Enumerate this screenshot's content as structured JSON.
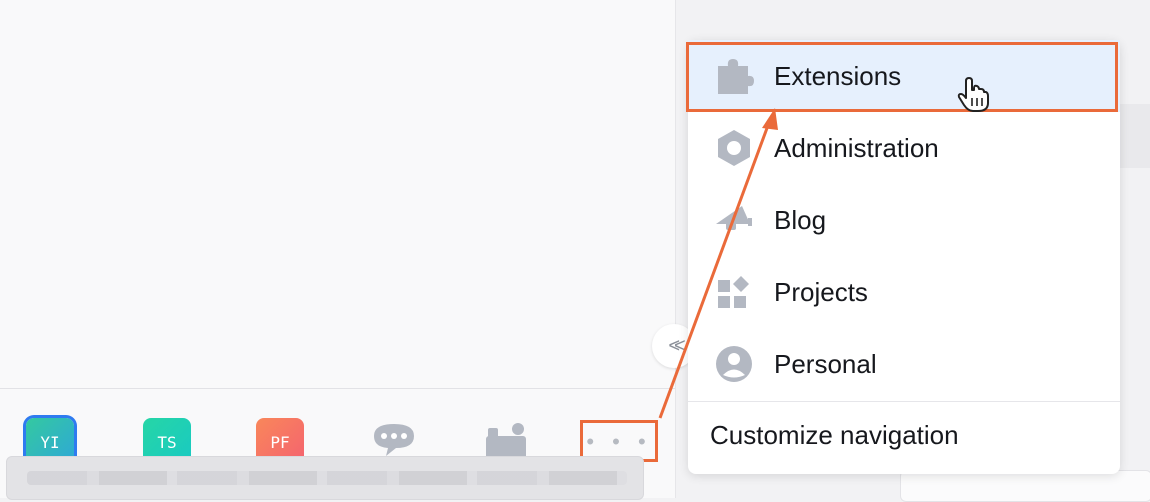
{
  "tabs": [
    {
      "label": "YI"
    },
    {
      "label": "TS"
    },
    {
      "label": "PF"
    }
  ],
  "tab_icons": [
    "chat-bubble-icon",
    "command-icon"
  ],
  "more": {
    "label": "• • •"
  },
  "collapse": {
    "label": "<<"
  },
  "menu": {
    "items": [
      {
        "label": "Extensions",
        "icon": "puzzle-icon"
      },
      {
        "label": "Administration",
        "icon": "hexagon-nut-icon"
      },
      {
        "label": "Blog",
        "icon": "megaphone-icon"
      },
      {
        "label": "Projects",
        "icon": "grid-shapes-icon"
      },
      {
        "label": "Personal",
        "icon": "user-avatar-icon"
      }
    ],
    "footer_label": "Customize navigation"
  },
  "colors": {
    "annotation": "#ea6a3a",
    "hover_bg": "#e6f0fd",
    "icon_gray": "#b3b8c2"
  }
}
